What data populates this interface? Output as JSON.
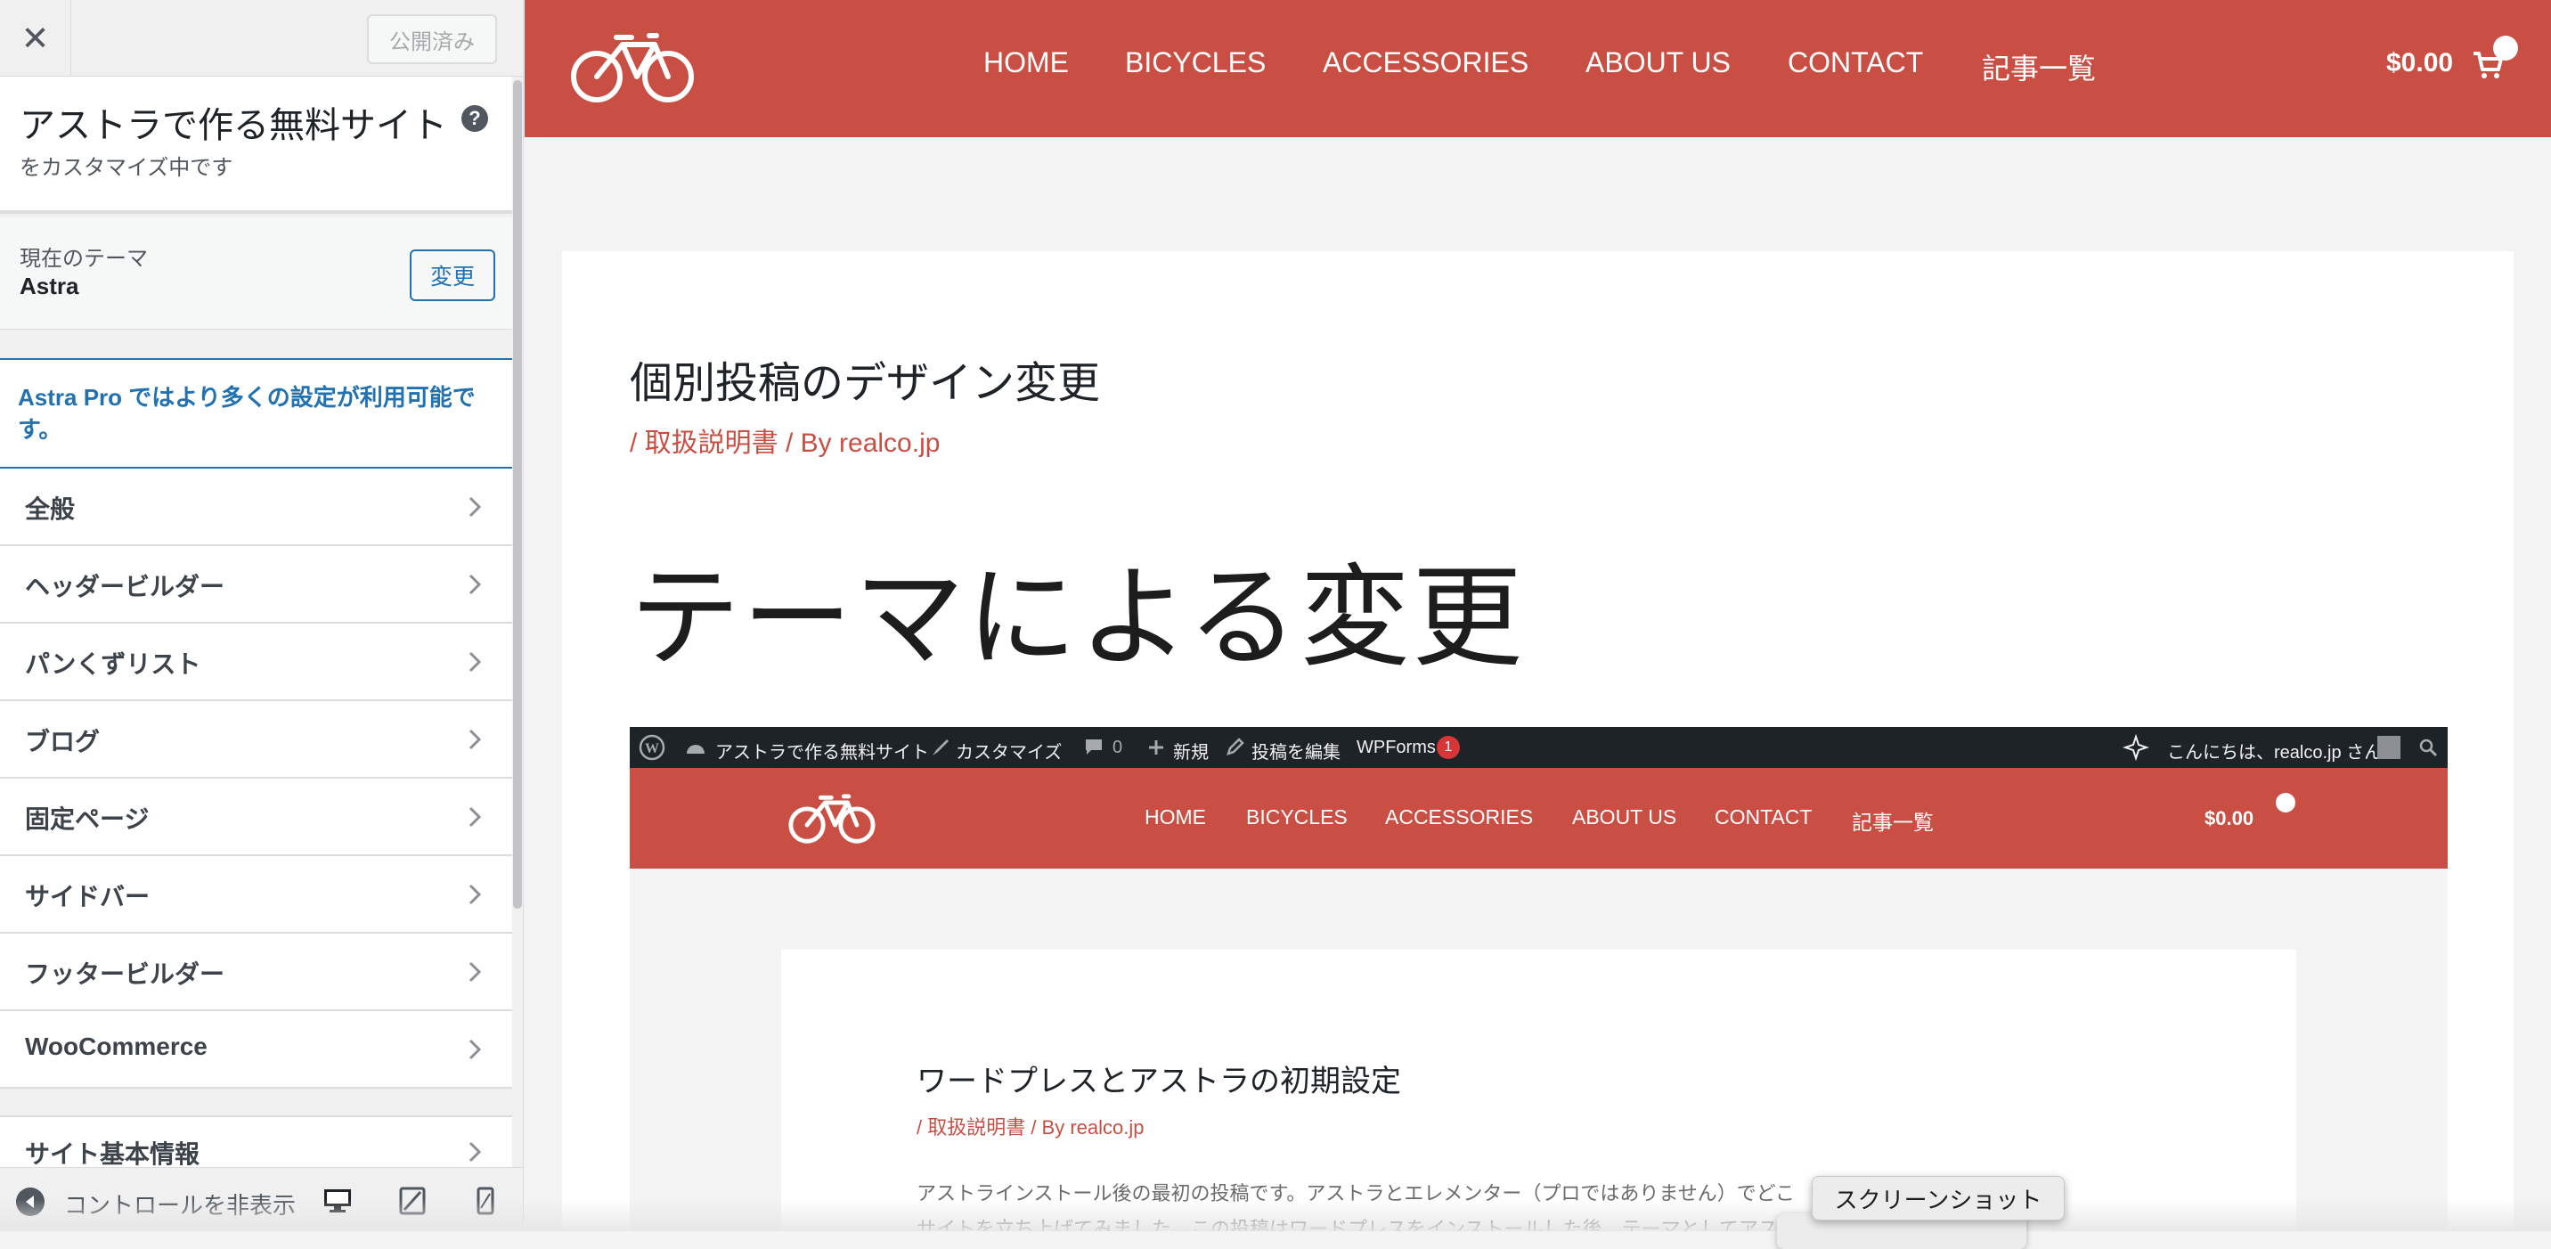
{
  "customizer": {
    "close_icon": "close-icon",
    "published_label": "公開済み",
    "site_title": "アストラで作る無料サイト",
    "customizing_label": "をカスタマイズ中です",
    "help_icon": "help-icon",
    "theme_label": "現在のテーマ",
    "theme_name": "Astra",
    "change_label": "変更",
    "promo_text": "Astra Pro ではより多くの設定が利用可能です。",
    "menu": [
      {
        "label": "全般"
      },
      {
        "label": "ヘッダービルダー"
      },
      {
        "label": "パンくずリスト"
      },
      {
        "label": "ブログ"
      },
      {
        "label": "固定ページ"
      },
      {
        "label": "サイドバー"
      },
      {
        "label": "フッタービルダー"
      },
      {
        "label": "WooCommerce"
      },
      {
        "label": "サイト基本情報"
      }
    ],
    "footer": {
      "hide_controls_label": "コントロールを非表示",
      "devices": [
        "desktop-icon",
        "tablet-icon",
        "mobile-icon"
      ]
    }
  },
  "preview": {
    "nav": [
      "HOME",
      "BICYCLES",
      "ACCESSORIES",
      "ABOUT US",
      "CONTACT",
      "記事一覧"
    ],
    "cart_total": "$0.00",
    "post_title": "個別投稿のデザイン変更",
    "post_meta": "/ 取扱説明書 / By realco.jp",
    "heading": "テーマによる変更",
    "screenshot": {
      "adminbar": {
        "site": "アストラで作る無料サイト",
        "customize": "カスタマイズ",
        "comments": "0",
        "new": "新規",
        "edit": "投稿を編集",
        "wpforms": "WPForms",
        "wpforms_count": "1",
        "greeting": "こんにちは、realco.jp さん"
      },
      "nav": [
        "HOME",
        "BICYCLES",
        "ACCESSORIES",
        "ABOUT US",
        "CONTACT",
        "記事一覧"
      ],
      "cart_total": "$0.00",
      "post_title": "ワードプレスとアストラの初期設定",
      "post_meta": "/ 取扱説明書 / By realco.jp",
      "body_line1": "アストラインストール後の最初の投稿です。アストラとエレメンター（プロではありません）でどこ",
      "body_line2": "サイトを立ち上げてみました。この投稿はワードプレスをインストールした後、テーマとしてアス"
    }
  },
  "tooltip": "スクリーンショット",
  "colors": {
    "brand": "#c94f44",
    "wp_blue": "#2271b1",
    "adminbar": "#1d2327"
  }
}
